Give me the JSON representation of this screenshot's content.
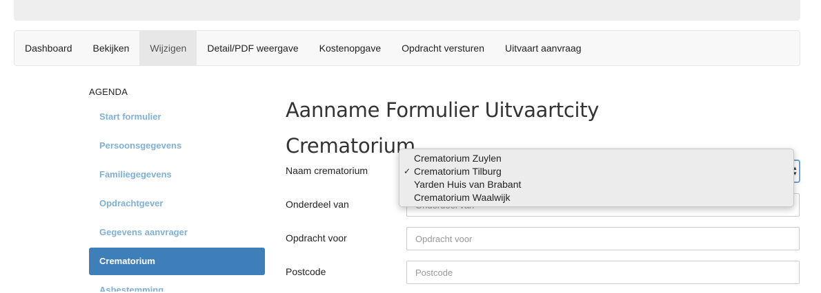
{
  "nav": {
    "items": [
      {
        "label": "Dashboard"
      },
      {
        "label": "Bekijken"
      },
      {
        "label": "Wijzigen",
        "active": true
      },
      {
        "label": "Detail/PDF weergave"
      },
      {
        "label": "Kostenopgave"
      },
      {
        "label": "Opdracht versturen"
      },
      {
        "label": "Uitvaart aanvraag"
      }
    ]
  },
  "sidebar": {
    "heading": "AGENDA",
    "items": [
      {
        "label": "Start formulier"
      },
      {
        "label": "Persoonsgegevens"
      },
      {
        "label": "Familiegegevens"
      },
      {
        "label": "Opdrachtgever"
      },
      {
        "label": "Gegevens aanvrager"
      },
      {
        "label": "Crematorium",
        "active": true
      },
      {
        "label": "Asbestemming"
      }
    ]
  },
  "main": {
    "title_line1": "Aanname Formulier Uitvaartcity",
    "title_line2": "Crematorium",
    "fields": {
      "naam_label": "Naam crematorium",
      "onderdeel_label": "Onderdeel van",
      "onderdeel_placeholder": "Onderdeel van",
      "opdracht_label": "Opdracht voor",
      "opdracht_placeholder": "Opdracht voor",
      "postcode_label": "Postcode",
      "postcode_placeholder": "Postcode"
    }
  },
  "dropdown": {
    "check_glyph": "✓",
    "options": [
      {
        "label": "Crematorium Zuylen"
      },
      {
        "label": "Crematorium Tilburg",
        "selected": true
      },
      {
        "label": "Yarden Huis van Brabant"
      },
      {
        "label": "Crematorium Waalwijk"
      }
    ]
  },
  "colors": {
    "sidebar_active_bg": "#3f7fb9",
    "sidebar_link": "#7fb0d6",
    "select_focus": "#6aa3e0"
  }
}
